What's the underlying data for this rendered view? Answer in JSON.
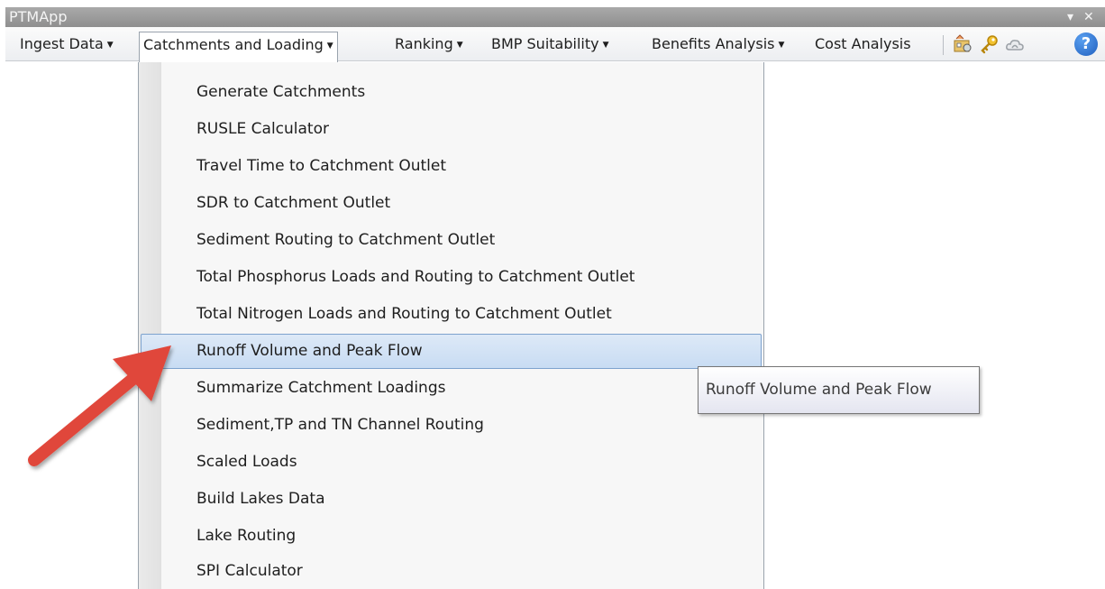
{
  "window": {
    "title": "PTMApp",
    "controls": {
      "dropdown_glyph": "▾",
      "close_glyph": "✕"
    }
  },
  "toolbar": {
    "menus": [
      {
        "label": "Ingest Data",
        "open": false
      },
      {
        "label": "Catchments and Loading",
        "open": true
      },
      {
        "label": "Ranking",
        "open": false
      },
      {
        "label": "BMP Suitability",
        "open": false
      },
      {
        "label": "Benefits Analysis",
        "open": false
      },
      {
        "label": "Cost Analysis",
        "open": false
      }
    ],
    "dropdown_arrow": "▼",
    "tools": [
      {
        "name": "identify-tool-icon"
      },
      {
        "name": "key-icon"
      },
      {
        "name": "cloud-icon"
      },
      {
        "name": "help-icon",
        "glyph": "?"
      }
    ]
  },
  "menu": {
    "items": [
      {
        "label": "Generate Catchments"
      },
      {
        "label": "RUSLE Calculator"
      },
      {
        "label": "Travel Time to Catchment Outlet"
      },
      {
        "label": "SDR to Catchment Outlet"
      },
      {
        "label": "Sediment Routing to Catchment Outlet"
      },
      {
        "label": "Total Phosphorus Loads and Routing to Catchment Outlet"
      },
      {
        "label": "Total Nitrogen Loads and Routing to Catchment Outlet"
      },
      {
        "label": "Runoff Volume and Peak Flow",
        "highlighted": true
      },
      {
        "label": "Summarize Catchment Loadings"
      },
      {
        "label": "Sediment,TP and TN Channel Routing"
      },
      {
        "label": "Scaled Loads"
      },
      {
        "label": "Build Lakes Data"
      },
      {
        "label": "Lake Routing"
      },
      {
        "label": "SPI Calculator"
      }
    ]
  },
  "tooltip": {
    "text": "Runoff Volume and Peak Flow"
  },
  "colors": {
    "annotation_arrow": "#e0463a",
    "highlight": "#cde0f6",
    "help_icon": "#2d6fcf"
  }
}
